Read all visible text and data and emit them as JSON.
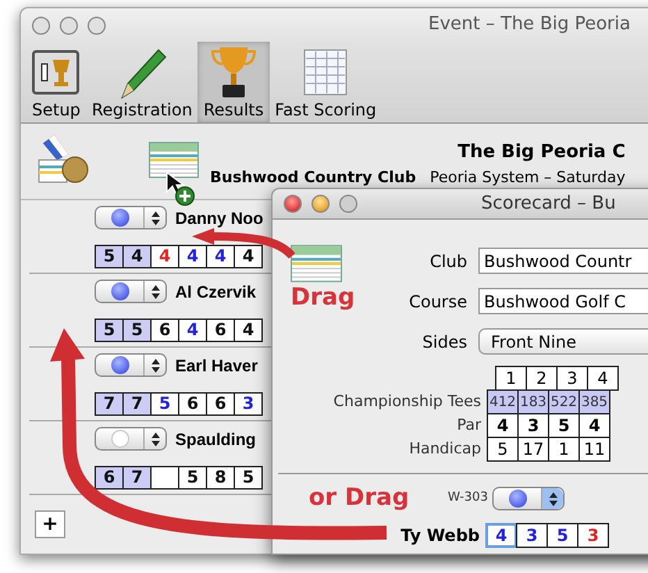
{
  "main_window": {
    "title": "Event – The Big Peoria",
    "toolbar": [
      {
        "label": "Setup",
        "kind": "setup",
        "selected": false
      },
      {
        "label": "Registration",
        "kind": "pencil",
        "selected": false
      },
      {
        "label": "Results",
        "kind": "trophy",
        "selected": true
      },
      {
        "label": "Fast Scoring",
        "kind": "sheet",
        "selected": false
      }
    ],
    "header": {
      "club": "Bushwood Country Club",
      "event_title": "The Big Peoria C",
      "event_subtitle": "Peoria System – Saturday"
    },
    "players": [
      {
        "name": "Danny Noo",
        "on": true,
        "scores": [
          {
            "value": "5",
            "shaded": true,
            "color": "#111111"
          },
          {
            "value": "4",
            "shaded": true,
            "color": "#111111"
          },
          {
            "value": "4",
            "shaded": false,
            "color": "#e02424"
          },
          {
            "value": "4",
            "shaded": false,
            "color": "#2222dd"
          },
          {
            "value": "4",
            "shaded": false,
            "color": "#2222dd"
          },
          {
            "value": "4",
            "shaded": false,
            "color": "#111111"
          }
        ]
      },
      {
        "name": "Al Czervik",
        "on": true,
        "scores": [
          {
            "value": "5",
            "shaded": true,
            "color": "#111111"
          },
          {
            "value": "5",
            "shaded": true,
            "color": "#111111"
          },
          {
            "value": "6",
            "shaded": false,
            "color": "#111111"
          },
          {
            "value": "4",
            "shaded": false,
            "color": "#2222dd"
          },
          {
            "value": "6",
            "shaded": false,
            "color": "#111111"
          },
          {
            "value": "4",
            "shaded": false,
            "color": "#111111"
          }
        ]
      },
      {
        "name": "Earl Haver",
        "on": true,
        "scores": [
          {
            "value": "7",
            "shaded": true,
            "color": "#111111"
          },
          {
            "value": "7",
            "shaded": true,
            "color": "#111111"
          },
          {
            "value": "5",
            "shaded": false,
            "color": "#2222dd"
          },
          {
            "value": "6",
            "shaded": false,
            "color": "#111111"
          },
          {
            "value": "6",
            "shaded": false,
            "color": "#111111"
          },
          {
            "value": "3",
            "shaded": false,
            "color": "#2222dd"
          }
        ]
      },
      {
        "name": "Spaulding",
        "on": false,
        "scores": [
          {
            "value": "6",
            "shaded": true,
            "color": "#111111"
          },
          {
            "value": "7",
            "shaded": true,
            "color": "#111111"
          },
          {
            "shaded": false
          },
          {
            "value": "5",
            "shaded": false,
            "color": "#111111"
          },
          {
            "value": "8",
            "shaded": false,
            "color": "#111111"
          },
          {
            "value": "5",
            "shaded": false,
            "color": "#111111"
          }
        ]
      }
    ],
    "add_button": "+"
  },
  "scorecard": {
    "title": "Scorecard – Bu",
    "fields": [
      {
        "label": "Club",
        "value": "Bushwood Countr",
        "kind": "text"
      },
      {
        "label": "Course",
        "value": "Bushwood Golf C",
        "kind": "text"
      },
      {
        "label": "Sides",
        "value": "Front Nine",
        "kind": "popup"
      }
    ],
    "holes": [
      "1",
      "2",
      "3",
      "4"
    ],
    "rows": [
      {
        "label": "Championship Tees",
        "kind": "yardage",
        "values": [
          "412",
          "183",
          "522",
          "385"
        ]
      },
      {
        "label": "Par",
        "kind": "par",
        "values": [
          "4",
          "3",
          "5",
          "4"
        ]
      },
      {
        "label": "Handicap",
        "kind": "plain",
        "values": [
          "5",
          "17",
          "1",
          "11"
        ]
      }
    ],
    "player": {
      "code": "W-303",
      "on": true,
      "name": "Ty Webb",
      "scores": [
        {
          "value": "4",
          "color": "#2222dd",
          "focused": true
        },
        {
          "value": "3",
          "color": "#2222dd",
          "focused": false
        },
        {
          "value": "5",
          "color": "#2222dd",
          "focused": false
        },
        {
          "value": "3",
          "color": "#e02424",
          "focused": false
        }
      ]
    }
  },
  "annotations": [
    "Drag",
    "or Drag"
  ]
}
